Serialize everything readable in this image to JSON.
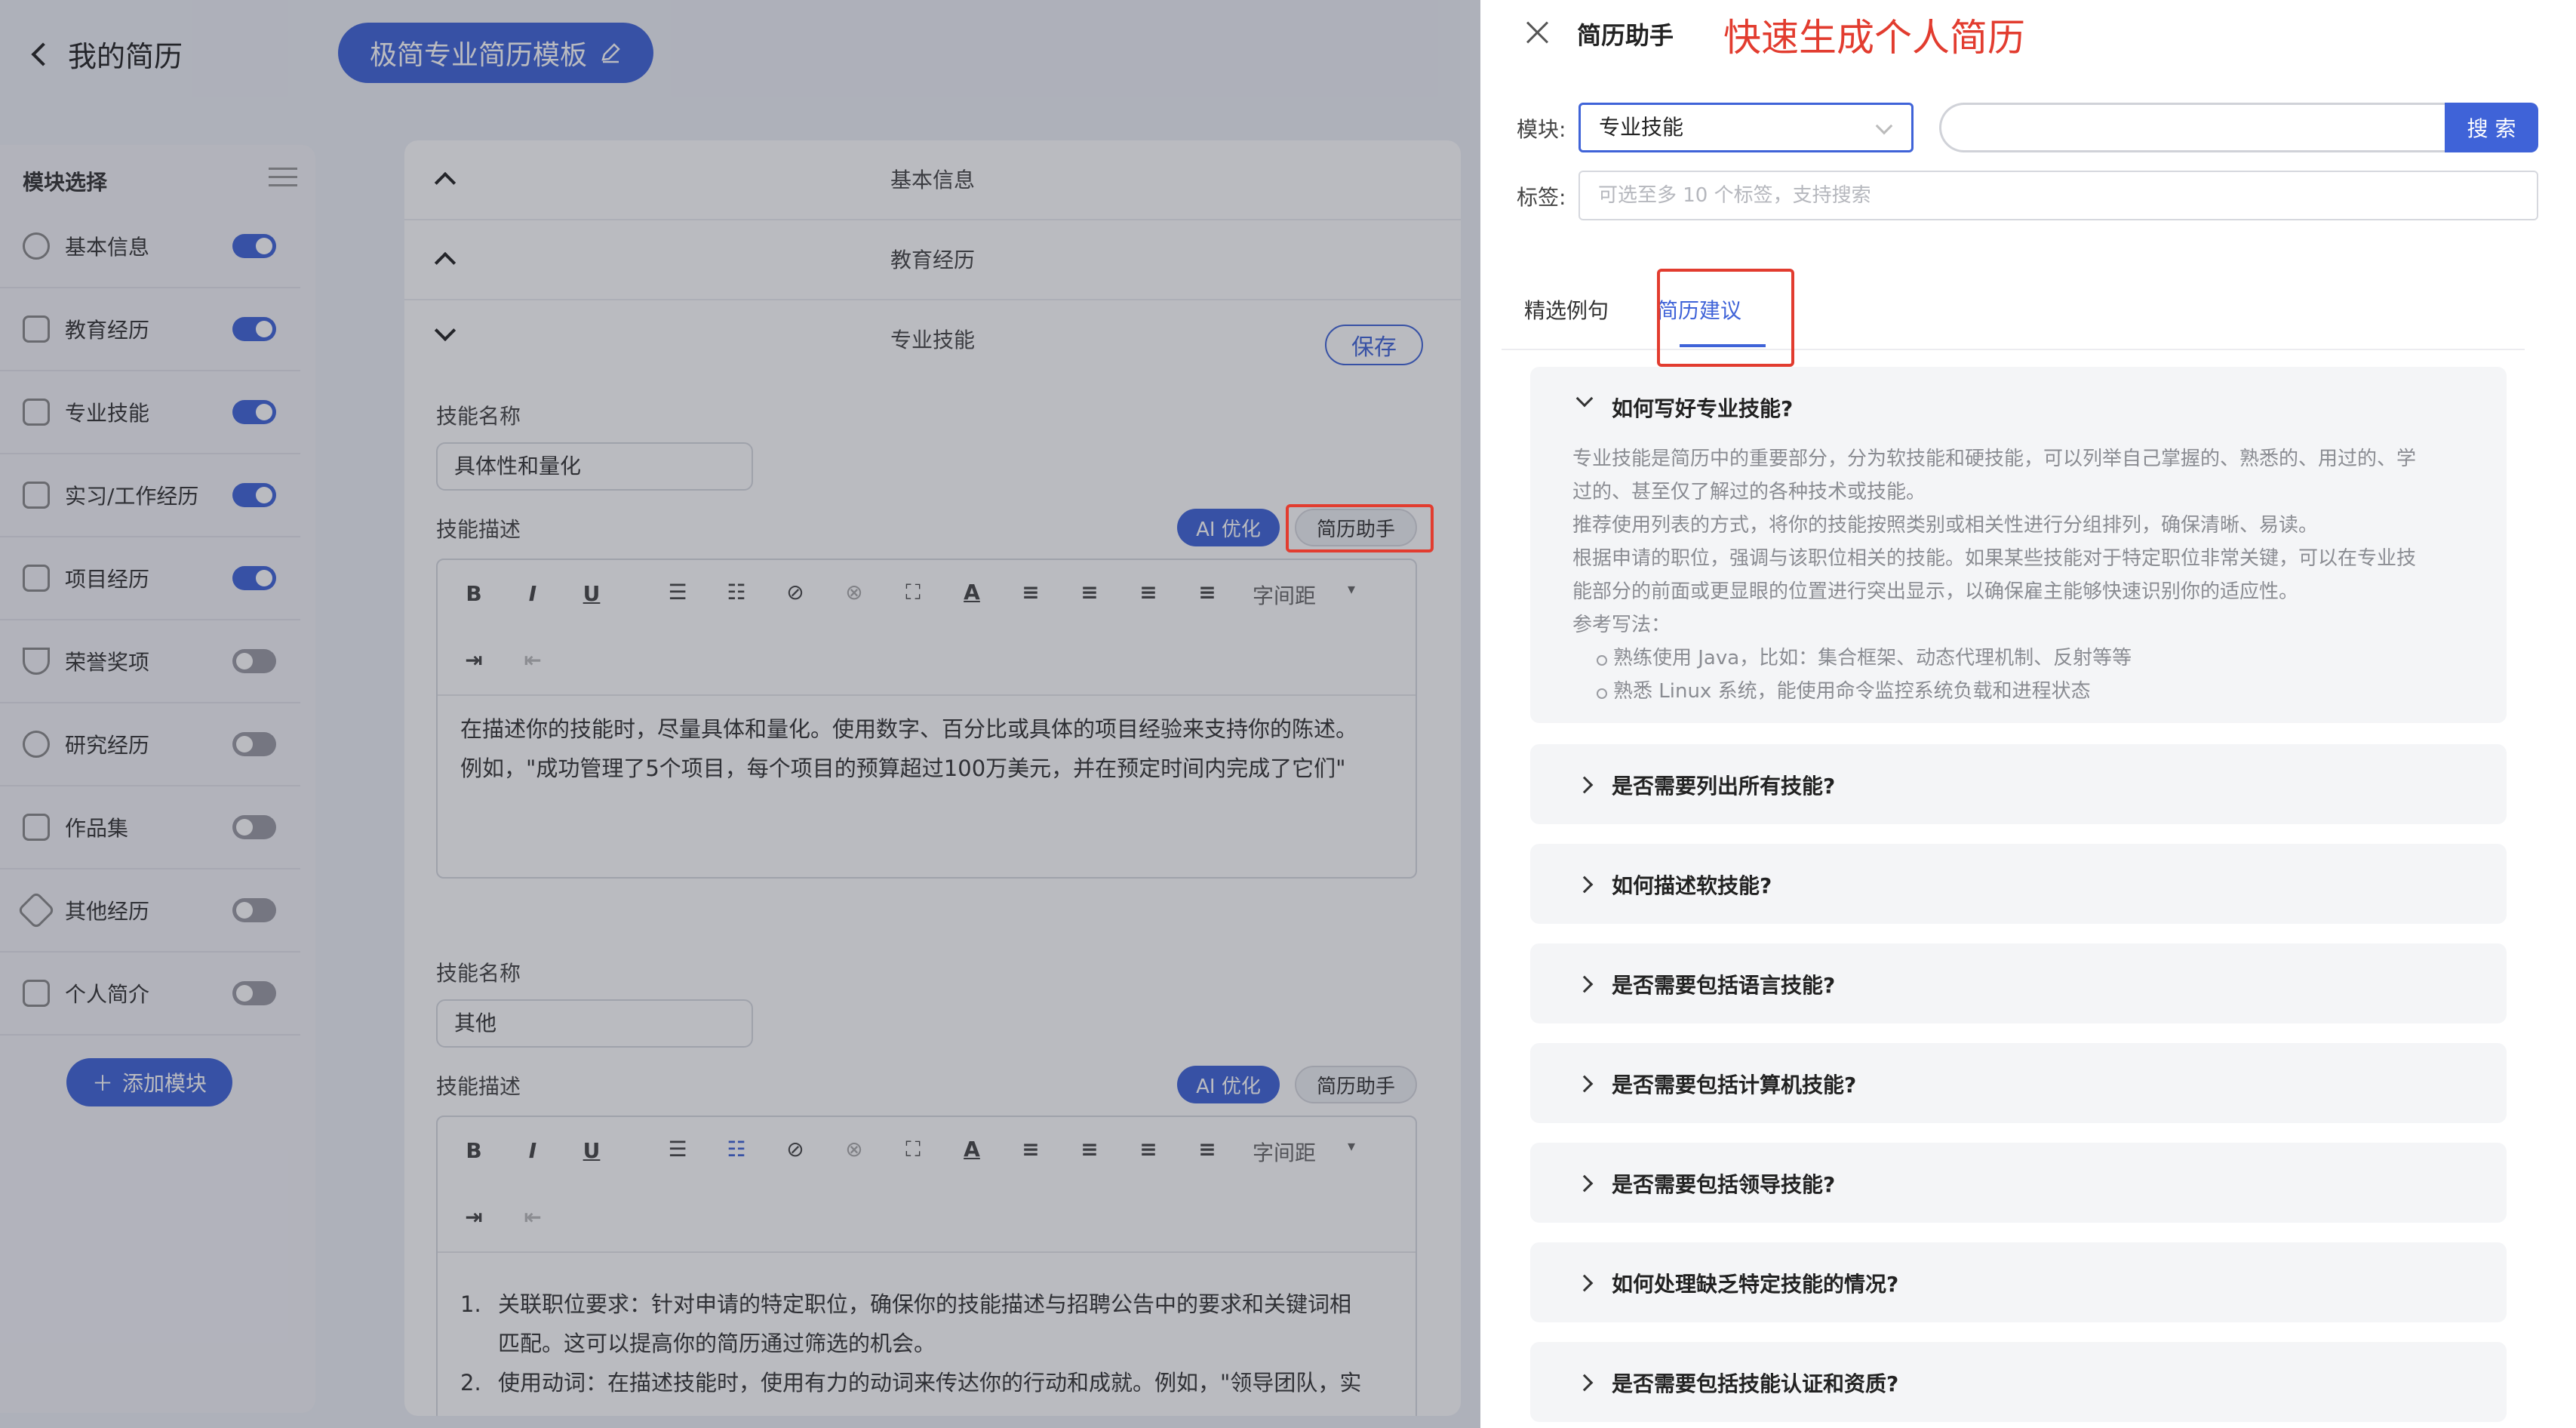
{
  "header": {
    "back_label": "我的简历",
    "template_name": "极简专业简历模板"
  },
  "sidebar": {
    "title": "模块选择",
    "items": [
      {
        "label": "基本信息",
        "enabled": true
      },
      {
        "label": "教育经历",
        "enabled": true
      },
      {
        "label": "专业技能",
        "enabled": true
      },
      {
        "label": "实习/工作经历",
        "enabled": true
      },
      {
        "label": "项目经历",
        "enabled": true
      },
      {
        "label": "荣誉奖项",
        "enabled": false
      },
      {
        "label": "研究经历",
        "enabled": false
      },
      {
        "label": "作品集",
        "enabled": false
      },
      {
        "label": "其他经历",
        "enabled": false
      },
      {
        "label": "个人简介",
        "enabled": false
      }
    ],
    "add_button": "添加模块"
  },
  "editor": {
    "sections": [
      "基本信息",
      "教育经历",
      "专业技能"
    ],
    "save_label": "保存",
    "skill_name_label": "技能名称",
    "skill_desc_label": "技能描述",
    "ai_label": "AI 优化",
    "assistant_label": "简历助手",
    "spacing_label": "字间距",
    "skills": [
      {
        "name": "具体性和量化",
        "desc_lines": [
          "在描述你的技能时，尽量具体和量化。使用数字、百分比或具体的项目经验来支持你的陈述。",
          "例如，\"成功管理了5个项目，每个项目的预算超过100万美元，并在预定时间内完成了它们\""
        ]
      },
      {
        "name": "其他",
        "list_items": [
          {
            "num": "1.",
            "lines": [
              "关联职位要求：针对申请的特定职位，确保你的技能描述与招聘公告中的要求和关键词相",
              "匹配。这可以提高你的简历通过筛选的机会。"
            ]
          },
          {
            "num": "2.",
            "lines": [
              "使用动词：在描述技能时，使用有力的动词来传达你的行动和成就。例如，\"领导团队，实"
            ]
          }
        ]
      }
    ]
  },
  "drawer": {
    "title": "简历助手",
    "slogan": "快速生成个人简历",
    "module_label": "模块:",
    "module_value": "专业技能",
    "search_button": "搜 索",
    "tags_label": "标签:",
    "tags_placeholder": "可选至多 10 个标签，支持搜索",
    "tabs": [
      "精选例句",
      "简历建议"
    ],
    "active_tab": 1,
    "faq": [
      {
        "q": "如何写好专业技能?",
        "expanded": true,
        "lines": [
          "专业技能是简历中的重要部分，分为软技能和硬技能，可以列举自己掌握的、熟悉的、用过的、学",
          "过的、甚至仅了解过的各种技术或技能。",
          "推荐使用列表的方式，将你的技能按照类别或相关性进行分组排列，确保清晰、易读。",
          "根据申请的职位，强调与该职位相关的技能。如果某些技能对于特定职位非常关键，可以在专业技",
          "能部分的前面或更显眼的位置进行突出显示，以确保雇主能够快速识别你的适应性。",
          "参考写法："
        ],
        "bullets": [
          "熟练使用 Java，比如：集合框架、动态代理机制、反射等等",
          "熟悉 Linux 系统，能使用命令监控系统负载和进程状态"
        ]
      },
      {
        "q": "是否需要列出所有技能?",
        "expanded": false
      },
      {
        "q": "如何描述软技能?",
        "expanded": false
      },
      {
        "q": "是否需要包括语言技能?",
        "expanded": false
      },
      {
        "q": "是否需要包括计算机技能?",
        "expanded": false
      },
      {
        "q": "是否需要包括领导技能?",
        "expanded": false
      },
      {
        "q": "如何处理缺乏特定技能的情况?",
        "expanded": false
      },
      {
        "q": "是否需要包括技能认证和资质?",
        "expanded": false
      }
    ]
  },
  "colors": {
    "accent": "#3f63d8",
    "highlight": "#e23c2f"
  }
}
